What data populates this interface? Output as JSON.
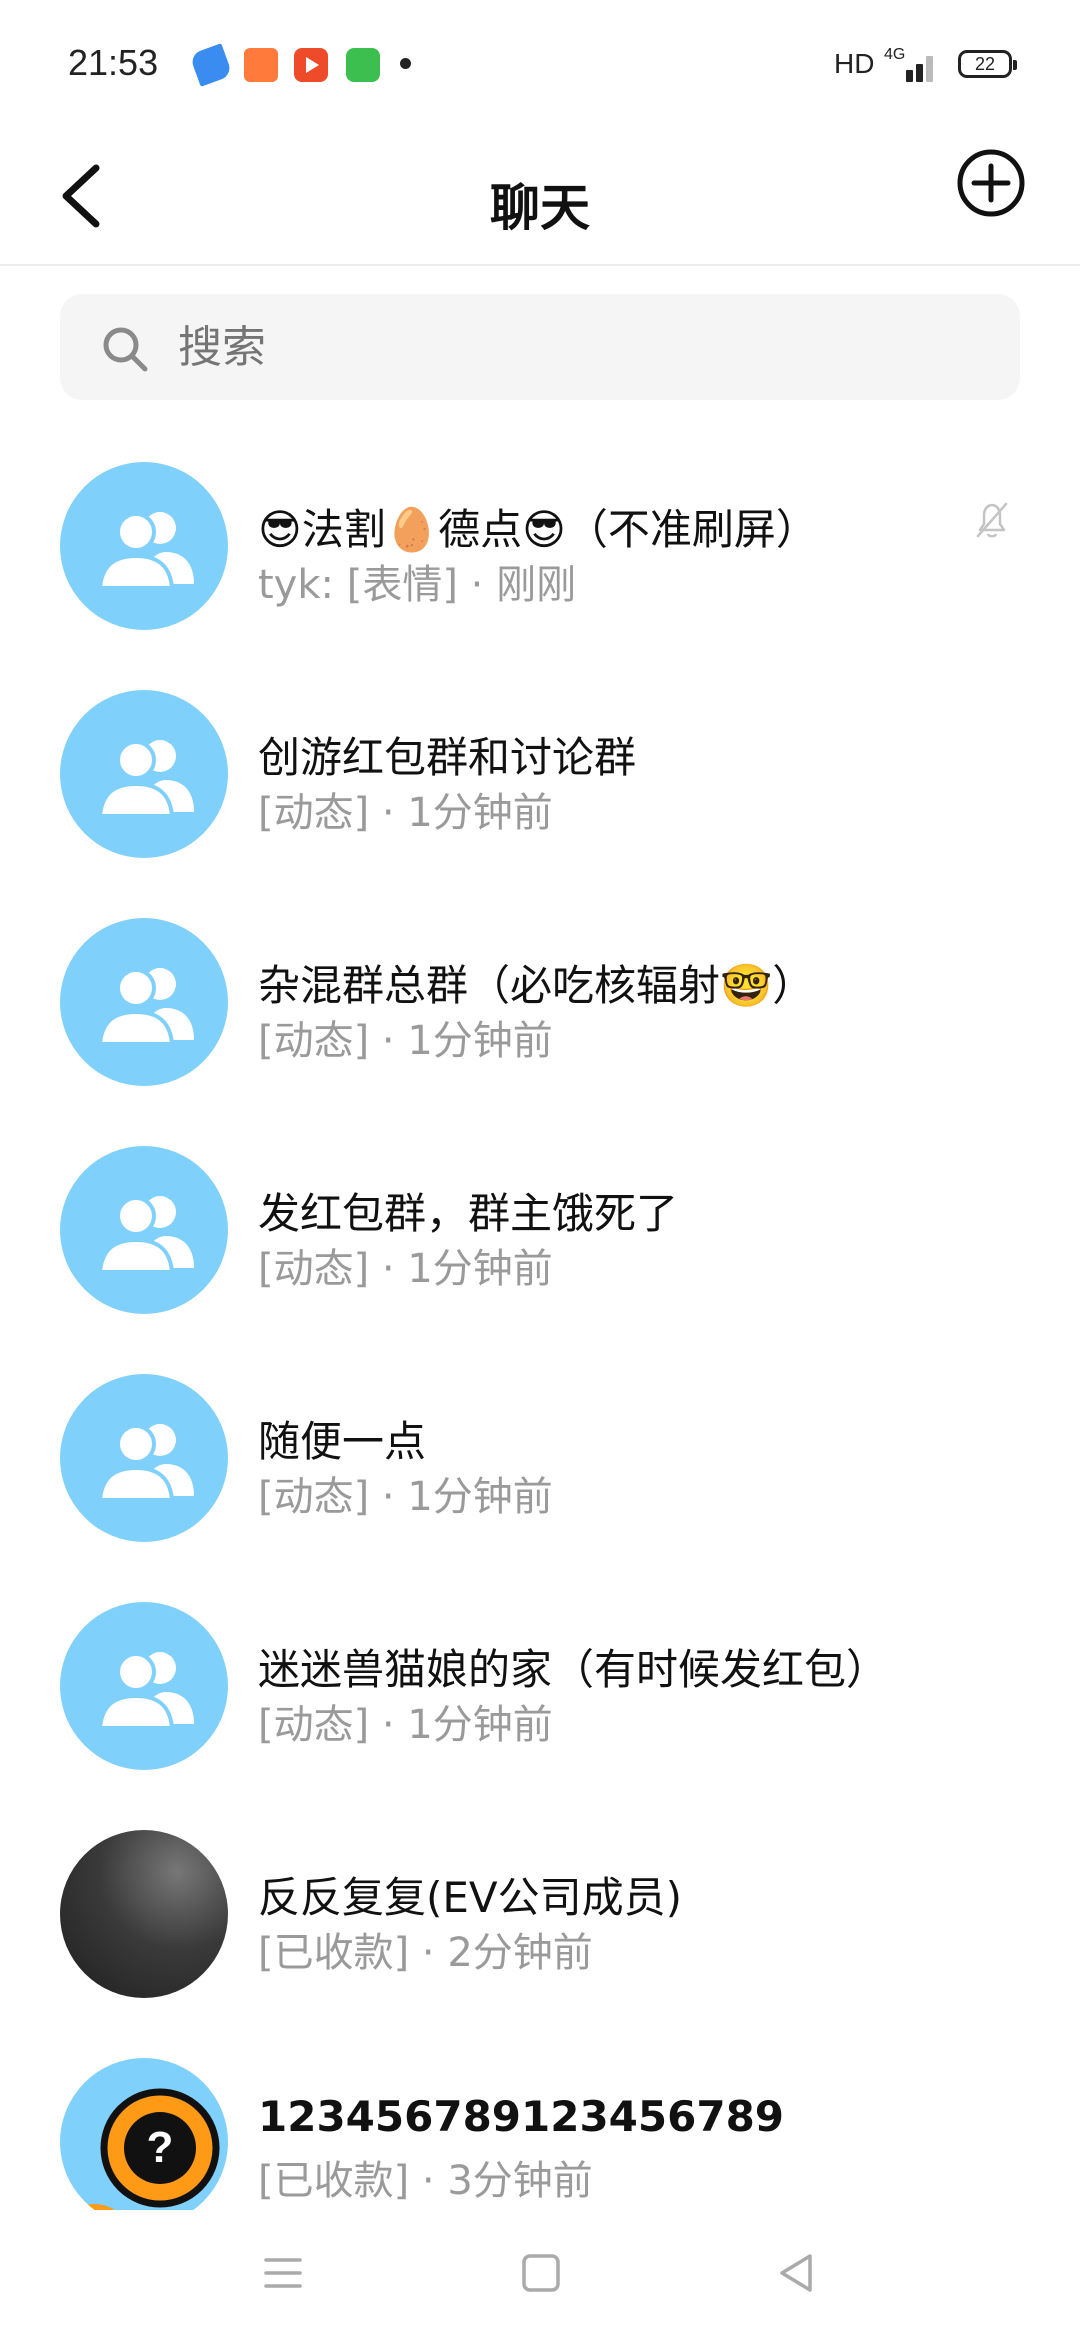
{
  "status_bar": {
    "time": "21:53",
    "network_label": "HD",
    "network_type": "4G",
    "battery_level": "22",
    "app_icons": [
      "blue-app-icon",
      "game-app-icon",
      "video-app-icon",
      "green-app-icon"
    ]
  },
  "header": {
    "title": "聊天",
    "back_icon": "chevron-left-icon",
    "add_icon": "plus-circle-icon"
  },
  "search": {
    "placeholder": "搜索"
  },
  "chats": [
    {
      "name": "😎法割🥚德点😎（不准刷屏）",
      "subtitle": "tyk: [表情] · 刚刚",
      "avatar": "group",
      "muted": true
    },
    {
      "name": "创游红包群和讨论群",
      "subtitle": "[动态] · 1分钟前",
      "avatar": "group",
      "muted": false
    },
    {
      "name": "杂混群总群（必吃核辐射🤓）",
      "subtitle": "[动态] · 1分钟前",
      "avatar": "group",
      "muted": false
    },
    {
      "name": "发红包群，群主饿死了",
      "subtitle": "[动态] · 1分钟前",
      "avatar": "group",
      "muted": false
    },
    {
      "name": "随便一点",
      "subtitle": "[动态] · 1分钟前",
      "avatar": "group",
      "muted": false
    },
    {
      "name": "迷迷兽猫娘的家（有时候发红包）",
      "subtitle": "[动态] · 1分钟前",
      "avatar": "group",
      "muted": false
    },
    {
      "name": "反反复复(EV公司成员)",
      "subtitle": "[已收款] · 2分钟前",
      "avatar": "dark",
      "muted": false
    },
    {
      "name": "123456789123456789",
      "subtitle": "[已收款] · 3分钟前",
      "avatar": "hero",
      "muted": false
    }
  ],
  "colors": {
    "avatar_bg": "#7fd0fb",
    "subtitle": "#9a9a9a",
    "search_bg": "#f5f5f5"
  },
  "nav_bar": {
    "icons": [
      "menu-icon",
      "home-square-icon",
      "back-triangle-icon"
    ]
  }
}
